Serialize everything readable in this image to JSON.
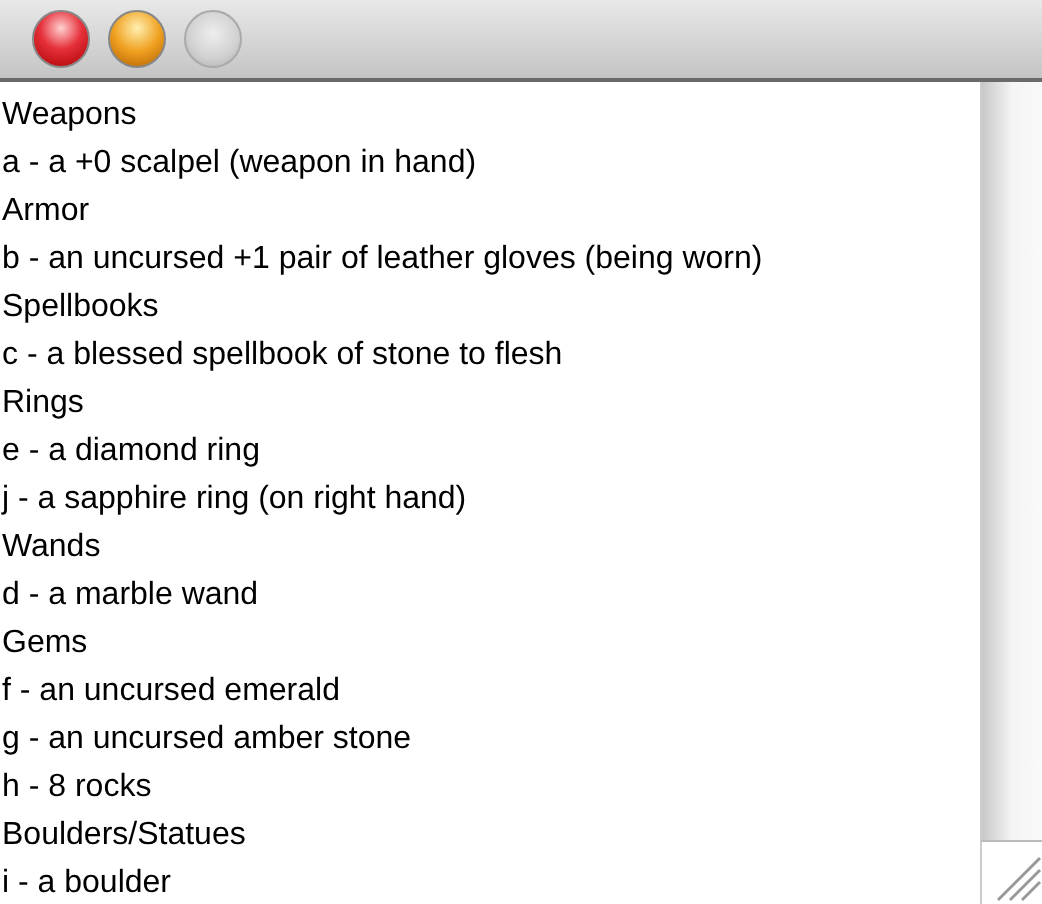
{
  "window": {
    "buttons": [
      {
        "kind": "close",
        "disabled": false
      },
      {
        "kind": "minimize",
        "disabled": false
      },
      {
        "kind": "zoom",
        "disabled": true
      }
    ]
  },
  "lines": [
    "Weapons",
    "a - a +0 scalpel (weapon in hand)",
    "Armor",
    "b - an uncursed +1 pair of leather gloves (being worn)",
    "Spellbooks",
    "c - a blessed spellbook of stone to flesh",
    "Rings",
    "e - a diamond ring",
    "j - a sapphire ring (on right hand)",
    "Wands",
    "d - a marble wand",
    "Gems",
    "f - an uncursed emerald",
    "g - an uncursed amber stone",
    "h - 8 rocks",
    "Boulders/Statues",
    "i - a boulder"
  ]
}
